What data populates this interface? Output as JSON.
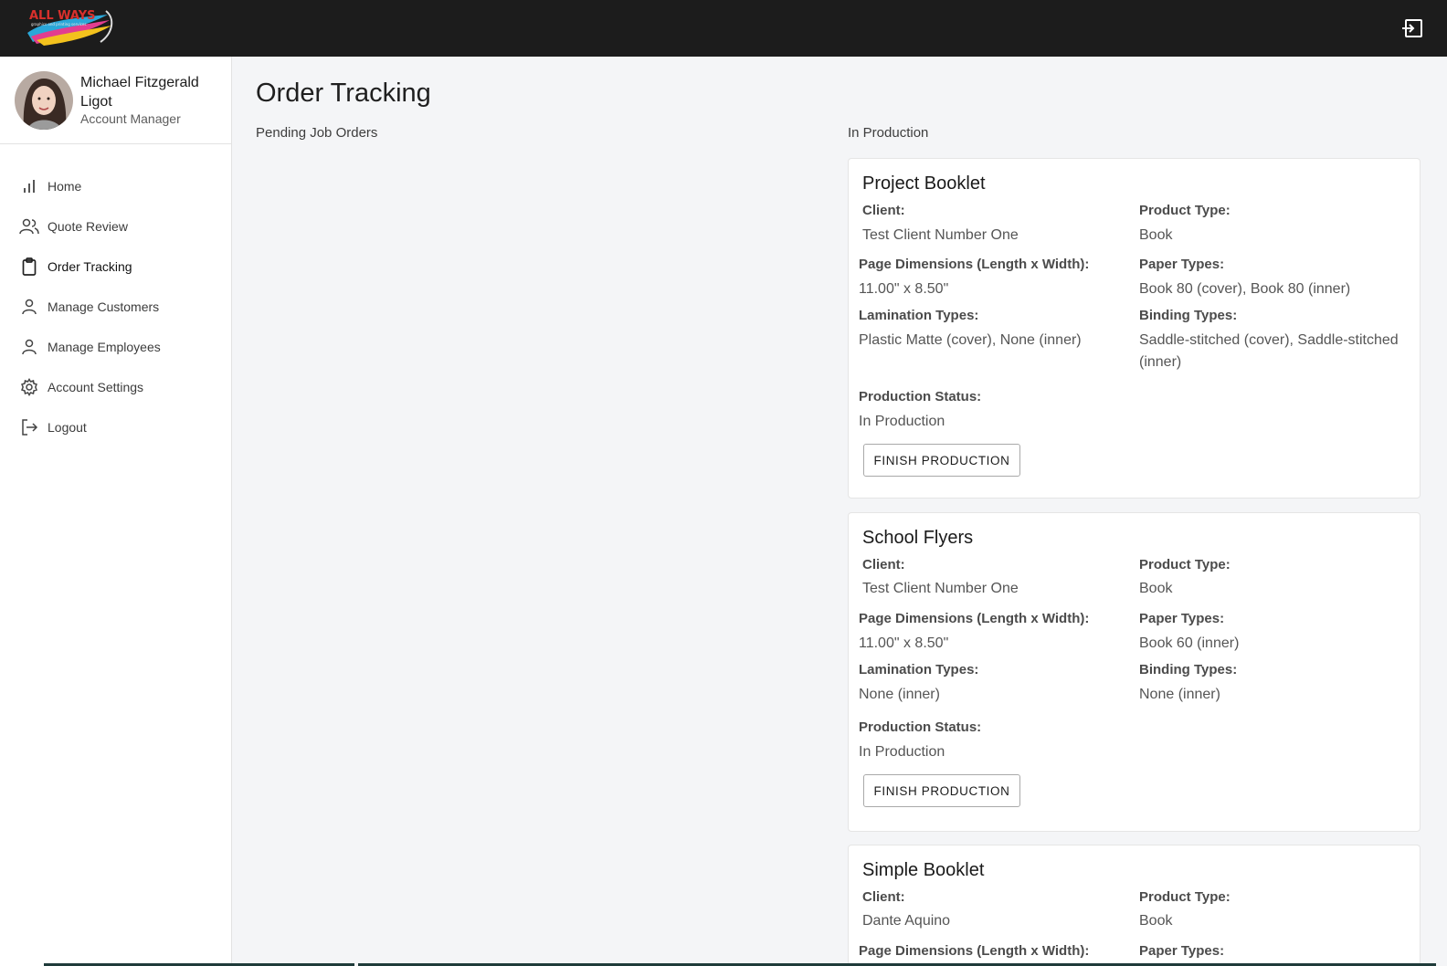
{
  "brand": {
    "logo_text": "ALL WAYS",
    "logo_tagline": "graphics and printing services"
  },
  "user": {
    "name": "Michael Fitzgerald Ligot",
    "role": "Account Manager"
  },
  "nav": [
    {
      "label": "Home",
      "icon": "bar-chart-icon"
    },
    {
      "label": "Quote Review",
      "icon": "users-icon"
    },
    {
      "label": "Order Tracking",
      "icon": "clipboard-icon",
      "active": true
    },
    {
      "label": "Manage Customers",
      "icon": "person-icon"
    },
    {
      "label": "Manage Employees",
      "icon": "person-icon"
    },
    {
      "label": "Account Settings",
      "icon": "gear-icon"
    },
    {
      "label": "Logout",
      "icon": "logout-icon"
    }
  ],
  "page": {
    "title": "Order Tracking",
    "pending_heading": "Pending Job Orders",
    "production_heading": "In Production"
  },
  "labels": {
    "client": "Client:",
    "product_type": "Product Type:",
    "page_dimensions": "Page Dimensions (Length x Width):",
    "paper_types": "Paper Types:",
    "lamination_types": "Lamination Types:",
    "binding_types": "Binding Types:",
    "production_status": "Production Status:",
    "finish_button": "FINISH PRODUCTION"
  },
  "orders": [
    {
      "title": "Project Booklet",
      "client": "Test Client Number One",
      "product_type": "Book",
      "page_dimensions": "11.00\" x 8.50\"",
      "paper_types": "Book 80 (cover), Book 80 (inner)",
      "lamination_types": "Plastic Matte (cover), None (inner)",
      "binding_types": "Saddle-stitched (cover), Saddle-stitched (inner)",
      "production_status": "In Production"
    },
    {
      "title": "School Flyers",
      "client": "Test Client Number One",
      "product_type": "Book",
      "page_dimensions": "11.00\" x 8.50\"",
      "paper_types": "Book 60 (inner)",
      "lamination_types": "None (inner)",
      "binding_types": "None (inner)",
      "production_status": "In Production"
    },
    {
      "title": "Simple Booklet",
      "client": "Dante Aquino",
      "product_type": "Book"
    }
  ],
  "colors": {
    "topbar": "#1c1c1c",
    "background": "#f4f5f7",
    "card": "#ffffff"
  }
}
